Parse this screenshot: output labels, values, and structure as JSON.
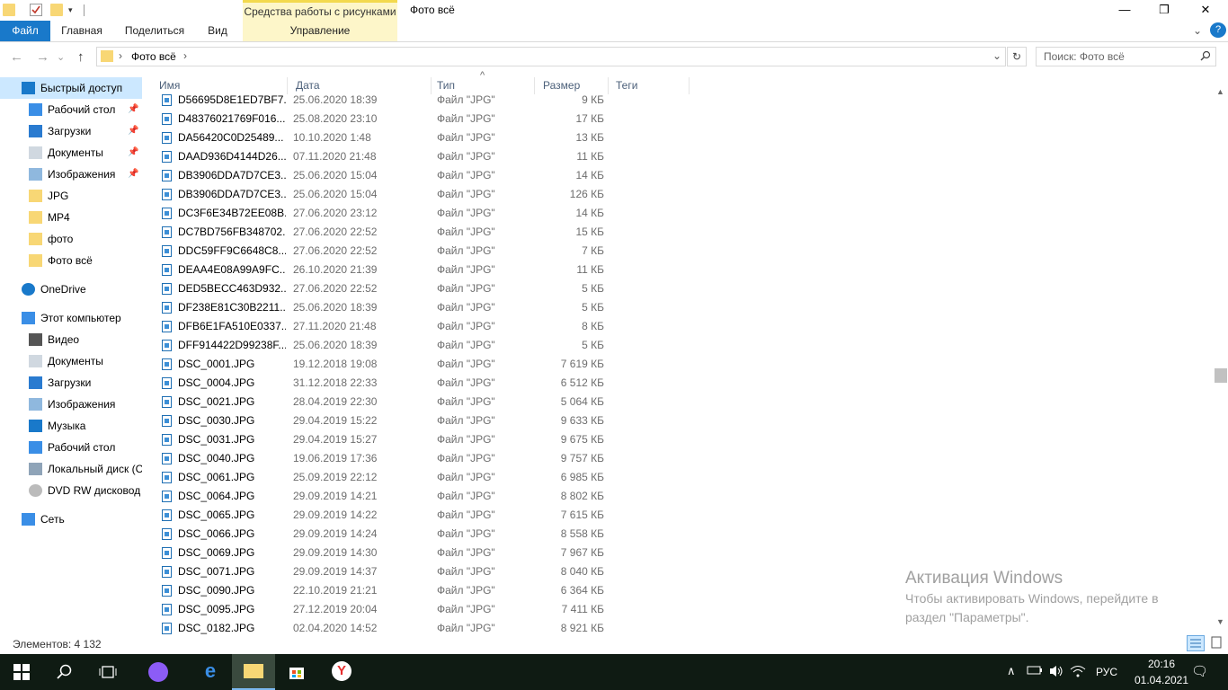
{
  "titlebar": {
    "tools_tab": "Средства работы с рисунками",
    "window_title": "Фото всё",
    "minimize": "—",
    "maximize": "❐",
    "close": "✕"
  },
  "ribbon": {
    "tabs": [
      "Файл",
      "Главная",
      "Поделиться",
      "Вид",
      "Управление"
    ],
    "expand": "⌄",
    "help": "?"
  },
  "address": {
    "back": "←",
    "forward": "→",
    "dropdown": "⌄",
    "up": "↑",
    "path": "Фото всё",
    "sep": "›",
    "refresh": "↻",
    "search_placeholder": "Поиск: Фото всё"
  },
  "navpane": {
    "items": [
      {
        "label": "Быстрый доступ",
        "icon": "star-icon",
        "selected": true
      },
      {
        "label": "Рабочий стол",
        "icon": "desktop-icon",
        "pinned": true
      },
      {
        "label": "Загрузки",
        "icon": "download-icon",
        "pinned": true
      },
      {
        "label": "Документы",
        "icon": "document-icon",
        "pinned": true
      },
      {
        "label": "Изображения",
        "icon": "image-icon",
        "pinned": true
      },
      {
        "label": "JPG",
        "icon": "folder-icon"
      },
      {
        "label": "MP4",
        "icon": "folder-icon"
      },
      {
        "label": "фото",
        "icon": "folder-icon"
      },
      {
        "label": "Фото всё",
        "icon": "folder-icon"
      },
      {
        "label": "OneDrive",
        "icon": "cloud-icon"
      },
      {
        "label": "Этот компьютер",
        "icon": "computer-icon"
      },
      {
        "label": "Видео",
        "icon": "video-icon"
      },
      {
        "label": "Документы",
        "icon": "document-icon"
      },
      {
        "label": "Загрузки",
        "icon": "download-icon"
      },
      {
        "label": "Изображения",
        "icon": "image-icon"
      },
      {
        "label": "Музыка",
        "icon": "music-icon"
      },
      {
        "label": "Рабочий стол",
        "icon": "desktop-icon"
      },
      {
        "label": "Локальный диск (С",
        "icon": "drive-icon"
      },
      {
        "label": "DVD RW дисковод (",
        "icon": "dvd-icon"
      },
      {
        "label": "Сеть",
        "icon": "network-icon"
      }
    ]
  },
  "columns": {
    "name": "Имя",
    "date": "Дата",
    "type": "Тип",
    "size": "Размер",
    "tags": "Теги",
    "sort_indicator": "^"
  },
  "files": [
    {
      "name": "D56695D8E1ED7BF7...",
      "date": "25.06.2020 18:39",
      "type": "Файл \"JPG\"",
      "size": "9 КБ"
    },
    {
      "name": "D48376021769F016...",
      "date": "25.08.2020 23:10",
      "type": "Файл \"JPG\"",
      "size": "17 КБ"
    },
    {
      "name": "DA56420C0D25489...",
      "date": "10.10.2020 1:48",
      "type": "Файл \"JPG\"",
      "size": "13 КБ"
    },
    {
      "name": "DAAD936D4144D26...",
      "date": "07.11.2020 21:48",
      "type": "Файл \"JPG\"",
      "size": "11 КБ"
    },
    {
      "name": "DB3906DDA7D7CE3...",
      "date": "25.06.2020 15:04",
      "type": "Файл \"JPG\"",
      "size": "14 КБ"
    },
    {
      "name": "DB3906DDA7D7CE3...",
      "date": "25.06.2020 15:04",
      "type": "Файл \"JPG\"",
      "size": "126 КБ"
    },
    {
      "name": "DC3F6E34B72EE08B...",
      "date": "27.06.2020 23:12",
      "type": "Файл \"JPG\"",
      "size": "14 КБ"
    },
    {
      "name": "DC7BD756FB348702...",
      "date": "27.06.2020 22:52",
      "type": "Файл \"JPG\"",
      "size": "15 КБ"
    },
    {
      "name": "DDC59FF9C6648C8...",
      "date": "27.06.2020 22:52",
      "type": "Файл \"JPG\"",
      "size": "7 КБ"
    },
    {
      "name": "DEAA4E08A99A9FC...",
      "date": "26.10.2020 21:39",
      "type": "Файл \"JPG\"",
      "size": "11 КБ"
    },
    {
      "name": "DED5BECC463D932...",
      "date": "27.06.2020 22:52",
      "type": "Файл \"JPG\"",
      "size": "5 КБ"
    },
    {
      "name": "DF238E81C30B2211...",
      "date": "25.06.2020 18:39",
      "type": "Файл \"JPG\"",
      "size": "5 КБ"
    },
    {
      "name": "DFB6E1FA510E0337...",
      "date": "27.11.2020 21:48",
      "type": "Файл \"JPG\"",
      "size": "8 КБ"
    },
    {
      "name": "DFF914422D99238F...",
      "date": "25.06.2020 18:39",
      "type": "Файл \"JPG\"",
      "size": "5 КБ"
    },
    {
      "name": "DSC_0001.JPG",
      "date": "19.12.2018 19:08",
      "type": "Файл \"JPG\"",
      "size": "7 619 КБ"
    },
    {
      "name": "DSC_0004.JPG",
      "date": "31.12.2018 22:33",
      "type": "Файл \"JPG\"",
      "size": "6 512 КБ"
    },
    {
      "name": "DSC_0021.JPG",
      "date": "28.04.2019 22:30",
      "type": "Файл \"JPG\"",
      "size": "5 064 КБ"
    },
    {
      "name": "DSC_0030.JPG",
      "date": "29.04.2019 15:22",
      "type": "Файл \"JPG\"",
      "size": "9 633 КБ"
    },
    {
      "name": "DSC_0031.JPG",
      "date": "29.04.2019 15:27",
      "type": "Файл \"JPG\"",
      "size": "9 675 КБ"
    },
    {
      "name": "DSC_0040.JPG",
      "date": "19.06.2019 17:36",
      "type": "Файл \"JPG\"",
      "size": "9 757 КБ"
    },
    {
      "name": "DSC_0061.JPG",
      "date": "25.09.2019 22:12",
      "type": "Файл \"JPG\"",
      "size": "6 985 КБ"
    },
    {
      "name": "DSC_0064.JPG",
      "date": "29.09.2019 14:21",
      "type": "Файл \"JPG\"",
      "size": "8 802 КБ"
    },
    {
      "name": "DSC_0065.JPG",
      "date": "29.09.2019 14:22",
      "type": "Файл \"JPG\"",
      "size": "7 615 КБ"
    },
    {
      "name": "DSC_0066.JPG",
      "date": "29.09.2019 14:24",
      "type": "Файл \"JPG\"",
      "size": "8 558 КБ"
    },
    {
      "name": "DSC_0069.JPG",
      "date": "29.09.2019 14:30",
      "type": "Файл \"JPG\"",
      "size": "7 967 КБ"
    },
    {
      "name": "DSC_0071.JPG",
      "date": "29.09.2019 14:37",
      "type": "Файл \"JPG\"",
      "size": "8 040 КБ"
    },
    {
      "name": "DSC_0090.JPG",
      "date": "22.10.2019 21:21",
      "type": "Файл \"JPG\"",
      "size": "6 364 КБ"
    },
    {
      "name": "DSC_0095.JPG",
      "date": "27.12.2019 20:04",
      "type": "Файл \"JPG\"",
      "size": "7 411 КБ"
    },
    {
      "name": "DSC_0182.JPG",
      "date": "02.04.2020 14:52",
      "type": "Файл \"JPG\"",
      "size": "8 921 КБ"
    }
  ],
  "status": {
    "item_count": "Элементов: 4 132"
  },
  "watermark": {
    "title": "Активация Windows",
    "text": "Чтобы активировать Windows, перейдите в раздел \"Параметры\"."
  },
  "taskbar": {
    "tray_chevron": "∧",
    "language": "РУС",
    "time": "20:16",
    "date": "01.04.2021",
    "notification": "🗨"
  },
  "colors": {
    "accent": "#1979ca",
    "selected": "#cce8ff",
    "tools_tab": "#fdf6c9",
    "taskbar": "#0f1b13",
    "folder": "#f8d775"
  }
}
